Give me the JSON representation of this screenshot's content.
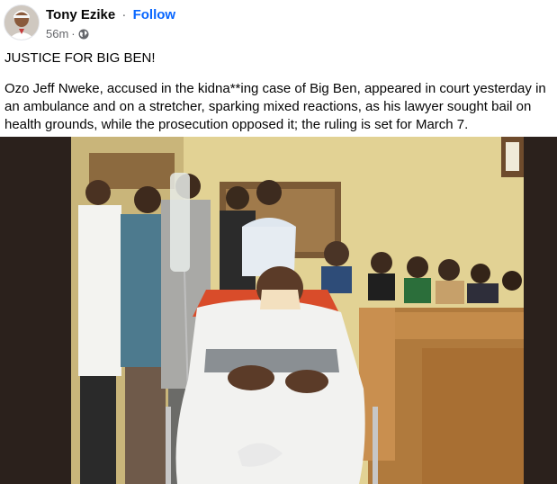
{
  "post": {
    "author_name": "Tony Ezike",
    "separator": "·",
    "follow_label": "Follow",
    "timestamp": "56m",
    "meta_separator": "·",
    "privacy_icon": "globe-icon",
    "headline": "JUSTICE FOR BIG BEN!",
    "body": "Ozo Jeff Nweke, accused in the kidna**ing case of Big Ben, appeared in court yesterday in an ambulance and on a stretcher, sparking mixed reactions, as his lawyer sought bail on health grounds, while the prosecution opposed it; the ruling is set for March 7."
  },
  "colors": {
    "follow": "#0866ff",
    "meta": "#65676b",
    "photo_backdrop": "#2b211c"
  }
}
